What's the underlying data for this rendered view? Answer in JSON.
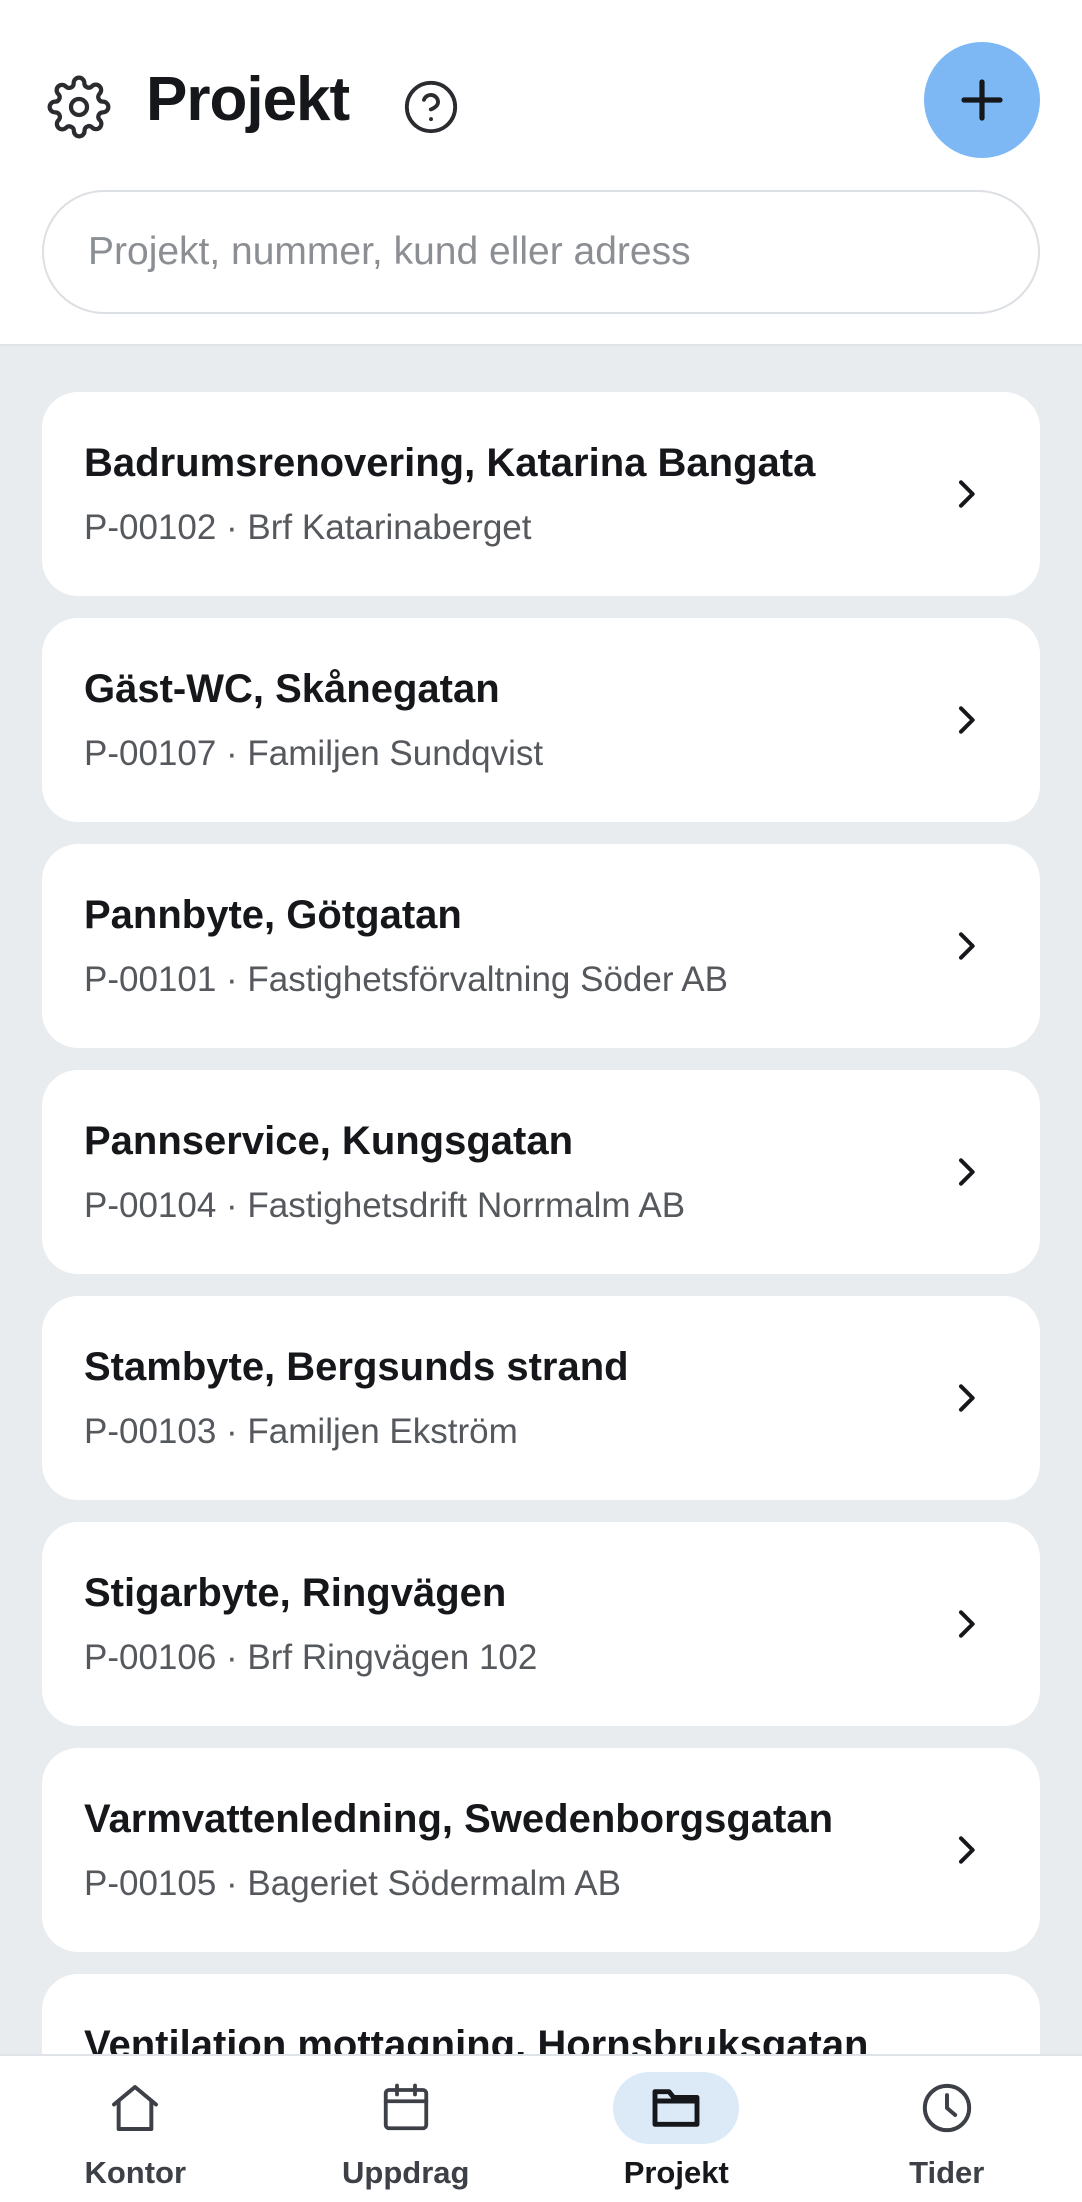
{
  "header": {
    "title": "Projekt",
    "settings_icon": "gear-icon",
    "help_icon": "question-circle-icon",
    "add_icon": "plus-icon",
    "accent_color": "#7eb8f4"
  },
  "search": {
    "placeholder": "Projekt, nummer, kund eller adress",
    "value": ""
  },
  "projects": [
    {
      "title": "Badrumsrenovering, Katarina Bangata",
      "subtitle": "P-00102 · Brf Katarinaberget"
    },
    {
      "title": "Gäst-WC, Skånegatan",
      "subtitle": "P-00107 · Familjen Sundqvist"
    },
    {
      "title": "Pannbyte, Götgatan",
      "subtitle": "P-00101 · Fastighetsförvaltning Söder AB"
    },
    {
      "title": "Pannservice, Kungsgatan",
      "subtitle": "P-00104 · Fastighetsdrift Norrmalm AB"
    },
    {
      "title": "Stambyte, Bergsunds strand",
      "subtitle": "P-00103 · Familjen Ekström"
    },
    {
      "title": "Stigarbyte, Ringvägen",
      "subtitle": "P-00106 · Brf Ringvägen 102"
    },
    {
      "title": "Varmvattenledning, Swedenborgsgatan",
      "subtitle": "P-00105 · Bageriet Södermalm AB"
    },
    {
      "title": "Ventilation mottagning, Hornsbruksgatan",
      "subtitle": ""
    }
  ],
  "bottom_nav": [
    {
      "label": "Kontor",
      "icon": "home-icon",
      "active": false
    },
    {
      "label": "Uppdrag",
      "icon": "calendar-icon",
      "active": false
    },
    {
      "label": "Projekt",
      "icon": "folder-icon",
      "active": true
    },
    {
      "label": "Tider",
      "icon": "clock-icon",
      "active": false
    }
  ]
}
